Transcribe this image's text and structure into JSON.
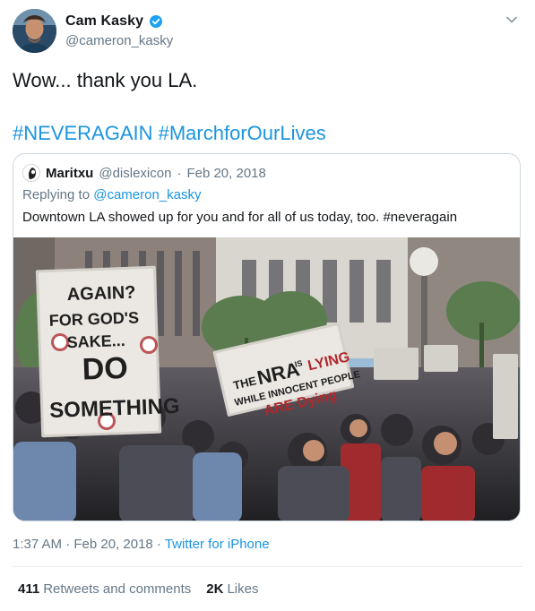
{
  "theme": {
    "accent": "#1b95e0",
    "text_primary": "#14171a",
    "text_secondary": "#657786",
    "border": "#ccd6dd",
    "verified": "#1da1f2"
  },
  "tweet": {
    "author": {
      "display_name": "Cam Kasky",
      "handle": "@cameron_kasky",
      "verified_icon": "verified-badge-icon",
      "avatar_icon": "avatar"
    },
    "menu_icon": "chevron-down-icon",
    "text": "Wow... thank you LA.",
    "hashtags": [
      "#NEVERAGAIN",
      "#MarchforOurLives"
    ],
    "quoted_tweet": {
      "author_name": "Maritxu",
      "author_handle": "@dislexicon",
      "separator": "·",
      "date": "Feb 20, 2018",
      "replying_prefix": "Replying to",
      "replying_handle": "@cameron_kasky",
      "text": "Downtown LA showed up for you and for all of us today, too. #neveragain",
      "media": {
        "sign_left_lines": [
          "AGAIN?",
          "FOR GOD'S",
          "SAKE...",
          "DO",
          "SOMETHING"
        ],
        "sign_right_lines": [
          "THE",
          "NRA",
          "IS",
          "LYING",
          "WHILE INNOCENT PEOPLE",
          "ARE Dying"
        ]
      }
    },
    "timestamp": "1:37 AM · Feb 20, 2018 ·",
    "source": "Twitter for iPhone",
    "stats": {
      "retweets_count": "411",
      "retweets_label": "Retweets and comments",
      "likes_count": "2K",
      "likes_label": "Likes"
    }
  }
}
